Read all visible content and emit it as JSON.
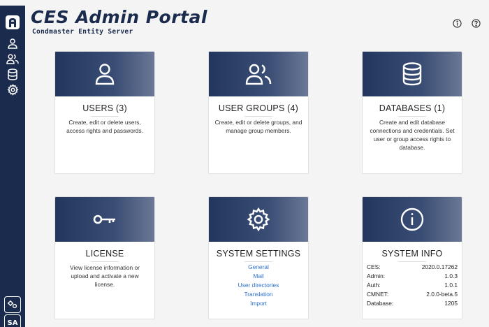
{
  "header": {
    "title": "CES Admin Portal",
    "subtitle": "Condmaster Entity Server"
  },
  "sidebar": {
    "logo_letter": "A",
    "items": [
      {
        "icon": "user-icon"
      },
      {
        "icon": "users-icon"
      },
      {
        "icon": "database-icon"
      },
      {
        "icon": "gear-icon"
      }
    ],
    "bottom_badge": "SA"
  },
  "cards": {
    "users": {
      "title": "USERS (3)",
      "desc": "Create, edit or delete users, access rights and passwords."
    },
    "groups": {
      "title": "USER GROUPS (4)",
      "desc": "Create, edit or delete groups, and manage group members."
    },
    "databases": {
      "title": "DATABASES (1)",
      "desc": "Create and edit database connections and credentials. Set user or group access rights to database."
    },
    "license": {
      "title": "LICENSE",
      "desc": "View license information or upload and activate a new license."
    },
    "settings": {
      "title": "SYSTEM SETTINGS",
      "links": [
        "General",
        "Mail",
        "User directories",
        "Translation",
        "Import"
      ]
    },
    "info": {
      "title": "SYSTEM INFO",
      "rows": [
        {
          "label": "CES:",
          "value": "2020.0.17262"
        },
        {
          "label": "Admin:",
          "value": "1.0.3"
        },
        {
          "label": "Auth:",
          "value": "1.0.1"
        },
        {
          "label": "CMNET:",
          "value": "2.0.0-beta.5"
        },
        {
          "label": "Database:",
          "value": "1205"
        }
      ]
    }
  },
  "colors": {
    "navy": "#1b2b4e",
    "link": "#2b6fd1"
  }
}
